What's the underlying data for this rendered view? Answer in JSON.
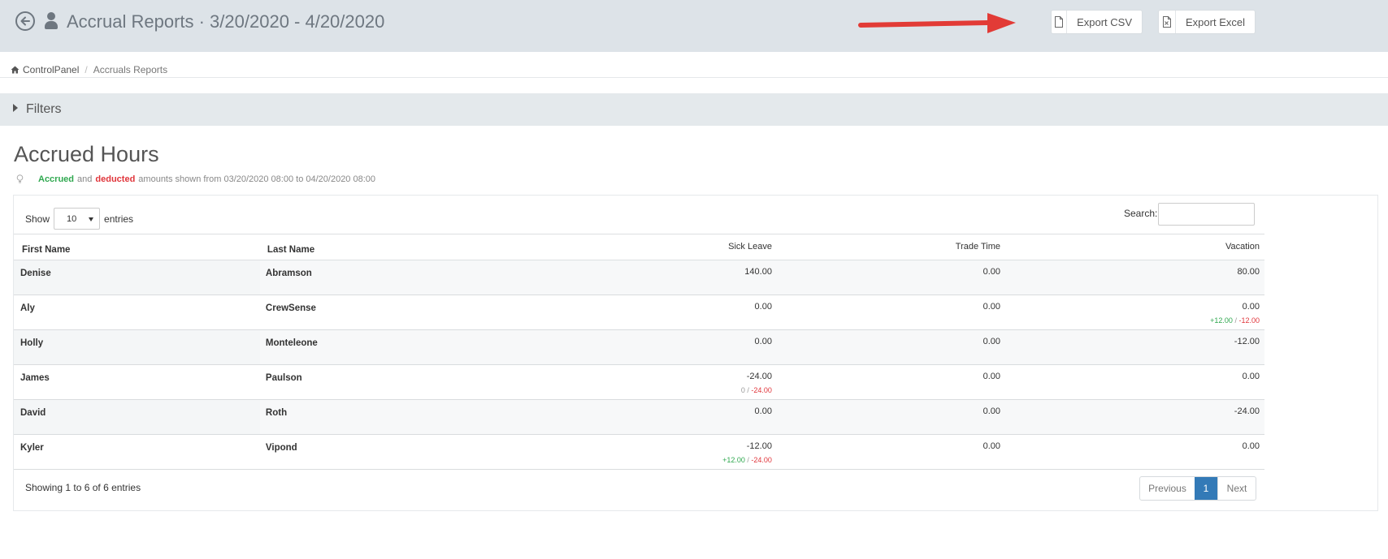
{
  "header": {
    "title": "Accrual Reports · 3/20/2020 - 4/20/2020",
    "export_csv_label": "Export CSV",
    "export_excel_label": "Export Excel"
  },
  "breadcrumb": {
    "home": "ControlPanel",
    "current": "Accruals Reports"
  },
  "filters": {
    "label": "Filters"
  },
  "section": {
    "title": "Accrued Hours",
    "legend_accrued": "Accrued",
    "legend_and": "and",
    "legend_deducted": "deducted",
    "legend_rest": "amounts shown from 03/20/2020 08:00 to 04/20/2020 08:00"
  },
  "table_controls": {
    "show_label": "Show",
    "page_size": "10",
    "entries_label": "entries",
    "search_label": "Search:",
    "search_value": ""
  },
  "table": {
    "columns": [
      "First Name",
      "Last Name",
      "Sick Leave",
      "Trade Time",
      "Vacation"
    ],
    "rows": [
      {
        "first": "Denise",
        "last": "Abramson",
        "sick": "140.00",
        "trade": "0.00",
        "vacation": "80.00"
      },
      {
        "first": "Aly",
        "last": "CrewSense",
        "sick": "0.00",
        "trade": "0.00",
        "vacation": "0.00",
        "vacation_accrued": "+12.00",
        "vacation_deducted": "-12.00"
      },
      {
        "first": "Holly",
        "last": "Monteleone",
        "sick": "0.00",
        "trade": "0.00",
        "vacation": "-12.00"
      },
      {
        "first": "James",
        "last": "Paulson",
        "sick": "-24.00",
        "sick_accrued": "0",
        "sick_deducted": "-24.00",
        "trade": "0.00",
        "vacation": "0.00"
      },
      {
        "first": "David",
        "last": "Roth",
        "sick": "0.00",
        "trade": "0.00",
        "vacation": "-24.00"
      },
      {
        "first": "Kyler",
        "last": "Vipond",
        "sick": "-12.00",
        "sick_accrued": "+12.00",
        "sick_deducted": "-24.00",
        "trade": "0.00",
        "vacation": "0.00"
      }
    ],
    "separator": "/"
  },
  "footer": {
    "showing": "Showing 1 to 6 of 6 entries",
    "previous": "Previous",
    "page": "1",
    "next": "Next"
  },
  "colors": {
    "accrued": "#2fa84f",
    "deducted": "#e0353b",
    "active_page": "#337ab7",
    "arrow": "#e23b36"
  }
}
